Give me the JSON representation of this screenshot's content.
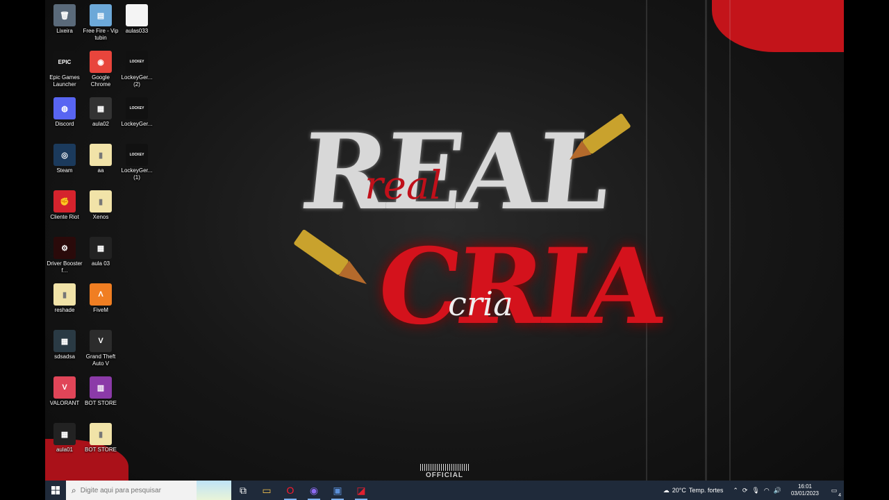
{
  "desktop": {
    "icons": [
      {
        "label": "Lixeira",
        "glyph": "🗑",
        "bg": "#5a6a7a"
      },
      {
        "label": "Free Fire - Vip tubin",
        "glyph": "▤",
        "bg": "#6ca8d8"
      },
      {
        "label": "aulas033",
        "glyph": "",
        "bg": "#f4f4f4"
      },
      {
        "label": "Epic Games Launcher",
        "glyph": "EPIC",
        "bg": "#111111"
      },
      {
        "label": "Google Chrome",
        "glyph": "◉",
        "bg": "#e8453c"
      },
      {
        "label": "LockeyGer... (2)",
        "glyph": "LOCKEY",
        "bg": "#111111"
      },
      {
        "label": "Discord",
        "glyph": "◍",
        "bg": "#5865f2"
      },
      {
        "label": "aula02",
        "glyph": "▦",
        "bg": "#333333"
      },
      {
        "label": "LockeyGer...",
        "glyph": "LOCKEY",
        "bg": "#111111"
      },
      {
        "label": "Steam",
        "glyph": "◎",
        "bg": "#1b3a5c"
      },
      {
        "label": "aa",
        "glyph": "▮",
        "bg": "#f1e3a8"
      },
      {
        "label": "LockeyGer... (1)",
        "glyph": "LOCKEY",
        "bg": "#111111"
      },
      {
        "label": "Cliente Riot",
        "glyph": "✊",
        "bg": "#d5232d"
      },
      {
        "label": "Xenos",
        "glyph": "▮",
        "bg": "#f1e3a8"
      },
      {
        "label": "Driver Booster f...",
        "glyph": "⚙",
        "bg": "#2a0a0a"
      },
      {
        "label": "aula 03",
        "glyph": "▦",
        "bg": "#222222"
      },
      {
        "label": "reshade",
        "glyph": "▮",
        "bg": "#f1e3a8"
      },
      {
        "label": "FiveM",
        "glyph": "Λ",
        "bg": "#f07e22"
      },
      {
        "label": "sdsadsa",
        "glyph": "▦",
        "bg": "#2a3a44"
      },
      {
        "label": "Grand Theft Auto V",
        "glyph": "V",
        "bg": "#2c2c2c"
      },
      {
        "label": "VALORANT",
        "glyph": "V",
        "bg": "#e04558"
      },
      {
        "label": "BOT STORE",
        "glyph": "▥",
        "bg": "#8b3aa8"
      },
      {
        "label": "aula01",
        "glyph": "▦",
        "bg": "#222222"
      },
      {
        "label": "BOT STORE",
        "glyph": "▮",
        "bg": "#f1e3a8"
      }
    ]
  },
  "wallpaper": {
    "title_top": "REAL",
    "title_bottom": "CRIA",
    "script_top": "real",
    "script_bottom": "cria",
    "badge": "OFFICIAL"
  },
  "taskbar": {
    "search_placeholder": "Digite aqui para pesquisar",
    "apps": [
      {
        "name": "task-view",
        "glyph": "⧉",
        "color": "#ffffff"
      },
      {
        "name": "file-explorer",
        "glyph": "▭",
        "color": "#f2c14e"
      },
      {
        "name": "opera",
        "glyph": "O",
        "color": "#ff1b2d"
      },
      {
        "name": "app-purple",
        "glyph": "◉",
        "color": "#8e6bf2"
      },
      {
        "name": "app-network",
        "glyph": "▣",
        "color": "#5b8fd8"
      },
      {
        "name": "app-red",
        "glyph": "◪",
        "color": "#e0202f"
      }
    ],
    "weather_temp": "20°C",
    "weather_text": "Temp. fortes",
    "time": "16:01",
    "date": "03/01/2023",
    "notif_count": "4"
  }
}
